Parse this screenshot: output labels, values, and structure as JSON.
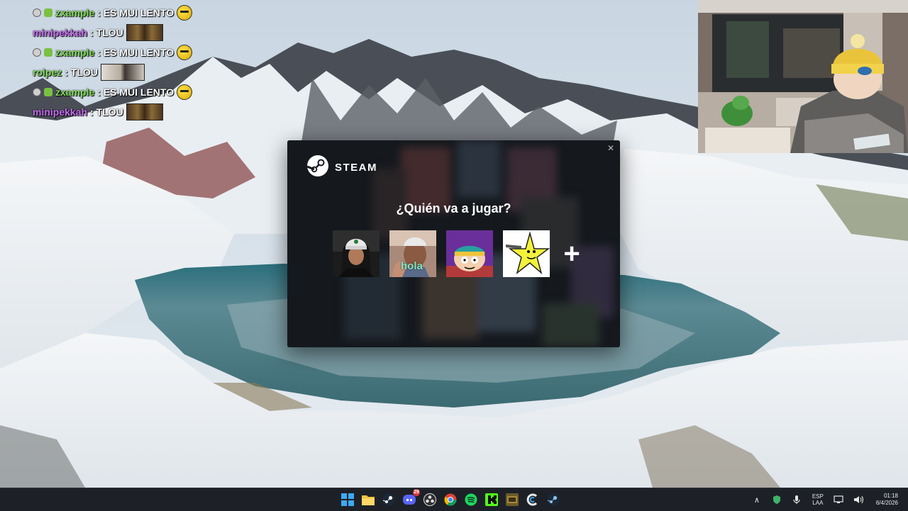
{
  "chat": {
    "messages": [
      {
        "user": "zxample",
        "text": ": ES MUI LENTO",
        "user_color": "#7ed957",
        "has_badges": true,
        "emote": "worried-emote"
      },
      {
        "user": "minipekkah",
        "text": ": TLOU",
        "user_color": "#c56cf0",
        "has_badges": false,
        "emote": "monkeys-emote"
      },
      {
        "user": "zxample",
        "text": ": ES MUI LENTO",
        "user_color": "#7ed957",
        "has_badges": true,
        "emote": "worried-emote"
      },
      {
        "user": "rolpez",
        "text": ": TLOU",
        "user_color": "#7ed957",
        "has_badges": false,
        "emote": "cat-emote"
      },
      {
        "user": "zxample",
        "text": ": ES MUI LENTO",
        "user_color": "#7ed957",
        "has_badges": true,
        "emote": "worried-emote"
      },
      {
        "user": "minipekkah",
        "text": ": TLOU",
        "user_color": "#c56cf0",
        "has_badges": false,
        "emote": "monkeys-emote"
      }
    ]
  },
  "steam": {
    "logo_text": "STEAM",
    "close_glyph": "✕",
    "heading": "¿Quién va a jugar?",
    "profiles": [
      {
        "name": "profile-1",
        "kind": "photo-cap"
      },
      {
        "name": "profile-2",
        "kind": "photo-kid",
        "caption": "hola"
      },
      {
        "name": "profile-3",
        "kind": "cartoon"
      },
      {
        "name": "profile-4",
        "kind": "star"
      }
    ],
    "add_glyph": "+"
  },
  "taskbar": {
    "apps": [
      {
        "name": "windows-start-icon"
      },
      {
        "name": "file-explorer-icon"
      },
      {
        "name": "steam-icon"
      },
      {
        "name": "discord-icon",
        "badge": "29"
      },
      {
        "name": "obs-icon"
      },
      {
        "name": "chrome-icon"
      },
      {
        "name": "spotify-icon"
      },
      {
        "name": "kick-icon"
      },
      {
        "name": "game-icon"
      },
      {
        "name": "ccleaner-icon"
      },
      {
        "name": "steam-icon-2"
      }
    ],
    "tray": {
      "chevron": "∧",
      "lang_line1": "ESP",
      "lang_line2": "LAA",
      "time": "01:18",
      "date": "6/4/2026"
    }
  },
  "colors": {
    "taskbar_bg": "#1d2127",
    "steam_dialog_bg": "#15191e",
    "accent_blue": "#0b78d4"
  }
}
